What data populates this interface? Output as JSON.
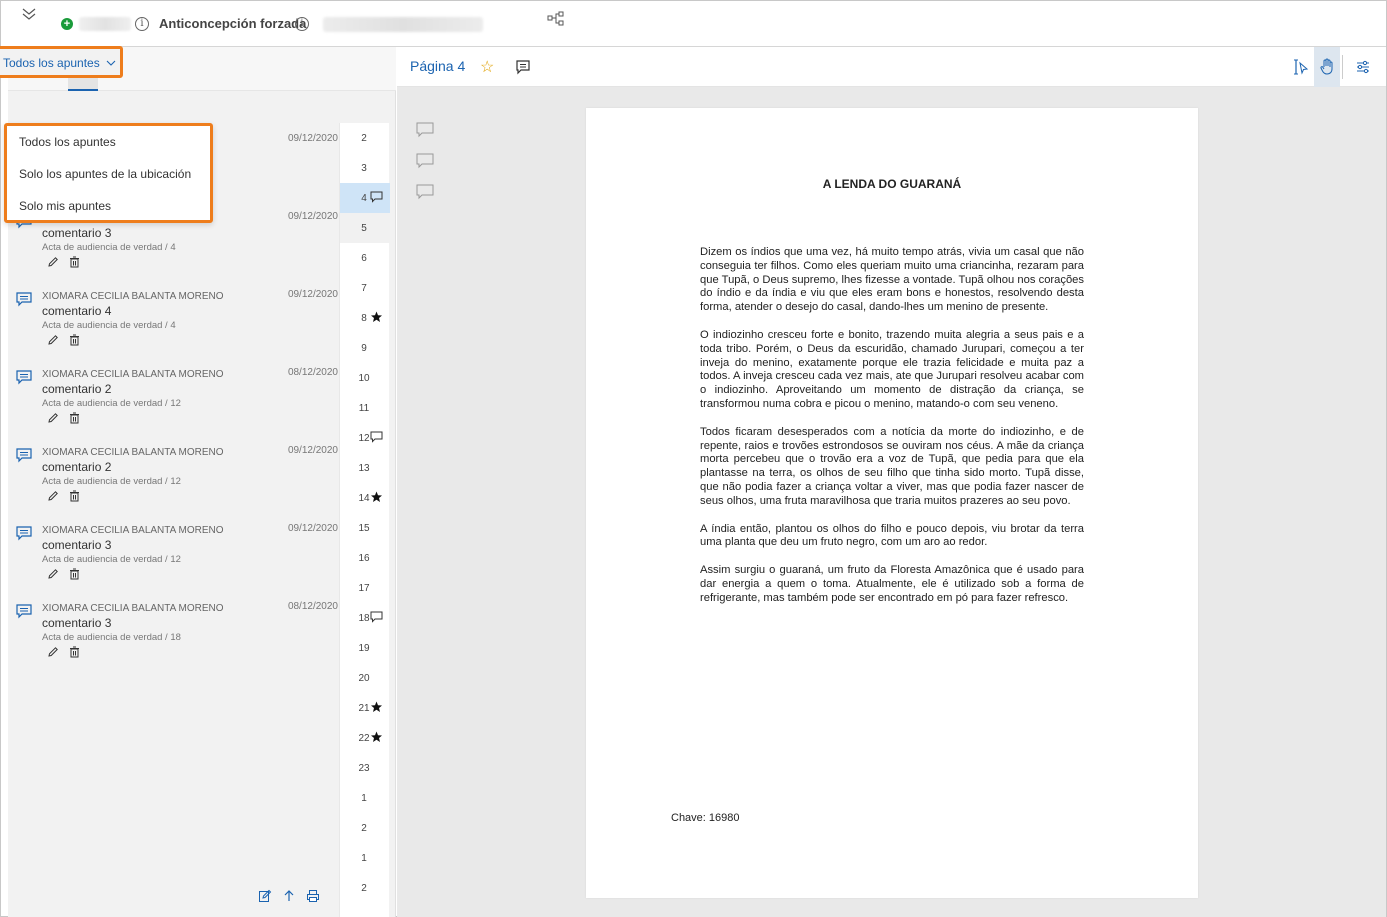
{
  "header": {
    "case_title": "Anticoncepción forzada"
  },
  "filter": {
    "selected": "Todos los apuntes",
    "options": [
      "Todos los apuntes",
      "Solo los apuntes de la ubicación",
      "Solo mis apuntes"
    ]
  },
  "notes": [
    {
      "author": "",
      "date": "09/12/2020",
      "title": "",
      "source": ""
    },
    {
      "author": "",
      "date": "09/12/2020",
      "title": "comentario 3",
      "source": "Acta de audiencia de verdad / 4"
    },
    {
      "author": "XIOMARA CECILIA BALANTA MORENO",
      "date": "09/12/2020",
      "title": "comentario 4",
      "source": "Acta de audiencia de verdad / 4"
    },
    {
      "author": "XIOMARA CECILIA BALANTA MORENO",
      "date": "08/12/2020",
      "title": "comentario 2",
      "source": "Acta de audiencia de verdad / 12"
    },
    {
      "author": "XIOMARA CECILIA BALANTA MORENO",
      "date": "09/12/2020",
      "title": "comentario 2",
      "source": "Acta de audiencia de verdad / 12"
    },
    {
      "author": "XIOMARA CECILIA BALANTA MORENO",
      "date": "09/12/2020",
      "title": "comentario 3",
      "source": "Acta de audiencia de verdad / 12"
    },
    {
      "author": "XIOMARA CECILIA BALANTA MORENO",
      "date": "08/12/2020",
      "title": "comentario 3",
      "source": "Acta de audiencia de verdad / 18"
    }
  ],
  "pages": [
    {
      "n": "2",
      "icon": ""
    },
    {
      "n": "3",
      "icon": ""
    },
    {
      "n": "4",
      "icon": "comment-icon"
    },
    {
      "n": "5",
      "icon": ""
    },
    {
      "n": "6",
      "icon": ""
    },
    {
      "n": "7",
      "icon": ""
    },
    {
      "n": "8",
      "icon": "star-icon"
    },
    {
      "n": "9",
      "icon": ""
    },
    {
      "n": "10",
      "icon": ""
    },
    {
      "n": "11",
      "icon": ""
    },
    {
      "n": "12",
      "icon": "comment-icon"
    },
    {
      "n": "13",
      "icon": ""
    },
    {
      "n": "14",
      "icon": "star-icon"
    },
    {
      "n": "15",
      "icon": ""
    },
    {
      "n": "16",
      "icon": ""
    },
    {
      "n": "17",
      "icon": ""
    },
    {
      "n": "18",
      "icon": "comment-icon"
    },
    {
      "n": "19",
      "icon": ""
    },
    {
      "n": "20",
      "icon": ""
    },
    {
      "n": "21",
      "icon": "star-icon"
    },
    {
      "n": "22",
      "icon": "star-icon"
    },
    {
      "n": "23",
      "icon": ""
    },
    {
      "n": "1",
      "icon": ""
    },
    {
      "n": "2",
      "icon": ""
    },
    {
      "n": "1",
      "icon": ""
    },
    {
      "n": "2",
      "icon": ""
    }
  ],
  "selected_page": "4",
  "viewer": {
    "page_label": "Página 4",
    "doc_title": "A LENDA DO GUARANÁ",
    "paragraphs": [
      "Dizem os índios que uma vez, há muito tempo atrás, vivia um casal que não conseguia ter filhos. Como eles queriam muito uma criancinha, rezaram para que Tupã, o Deus supremo, lhes fizesse a vontade. Tupã olhou nos corações do índio e da índia e viu que eles eram bons e honestos, resolvendo desta forma, atender o desejo do casal, dando-lhes um menino de presente.",
      "O indiozinho cresceu forte e bonito, trazendo muita alegria a seus pais e a toda tribo. Porém, o Deus da escuridão, chamado Jurupari, começou a ter inveja do menino, exatamente porque ele trazia felicidade e muita paz a todos. A inveja cresceu cada vez mais, ate que Jurupari resolveu acabar com o indiozinho. Aproveitando um momento de distração da criança, se transformou numa cobra e picou o menino, matando-o com seu veneno.",
      "Todos ficaram desesperados com a notícia da morte do indiozinho, e de repente, raios e trovões estrondosos se ouviram nos céus. A mãe da criança morta percebeu que o trovão era a voz de Tupã, que pedia para que ela plantasse na terra, os olhos de seu filho que tinha sido morto. Tupã disse, que não podia fazer a criança voltar a viver, mas que podia fazer nascer de seus olhos, uma fruta maravilhosa que traria muitos prazeres ao seu povo.",
      "A índia então, plantou os olhos do filho e pouco depois, viu brotar da terra uma planta que deu um fruto negro, com um aro ao redor.",
      "Assim surgiu o guaraná, um fruto da Floresta Amazônica que é usado para dar energia a quem o toma. Atualmente, ele é utilizado sob a forma de refrigerante, mas também pode ser encontrado em pó para fazer refresco."
    ],
    "key_text": "Chave: 16980"
  },
  "colors": {
    "accent": "#1b63b0",
    "highlight": "#ee7d1c",
    "status": "#1a9b3a",
    "star": "#e0a000"
  }
}
